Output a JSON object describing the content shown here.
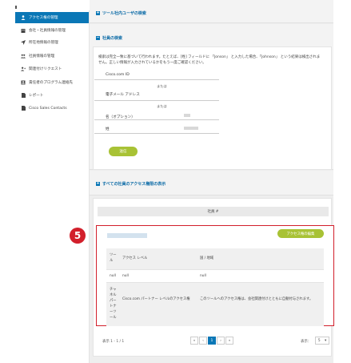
{
  "sidebar": {
    "items": [
      {
        "label": "アクセス権の管理",
        "icon": "users-icon",
        "active": true
      },
      {
        "label": "会社・社員情報の管理",
        "icon": "building-icon",
        "active": false
      },
      {
        "label": "所在地情報の管理",
        "icon": "location-arrow-icon",
        "active": false
      },
      {
        "label": "社員情報の管理",
        "icon": "group-icon",
        "active": false
      },
      {
        "label": "関連付けリクエスト",
        "icon": "user-add-icon",
        "active": false
      },
      {
        "label": "責任者のプログラム連絡先",
        "icon": "contact-icon",
        "active": false
      },
      {
        "label": "レポート",
        "icon": "document-icon",
        "active": false
      },
      {
        "label": "Cisco Sales Contacts",
        "icon": "document-icon",
        "active": false
      }
    ]
  },
  "sections": {
    "tool_user_search": "ツール社内ユーザの検索",
    "employee_search": "社員の検索",
    "all_access_display": "すべての社員のアクセス権限の表示"
  },
  "search_form": {
    "description": "検索は完全一致に基づいて行われます。たとえば、[姓] フィールドに 「Jonson」 と入力した場合、「Johnson」 という結果は検出されません。正しい情報が入力されているかをもう一度ご確認ください。",
    "cisco_id_label": "Cisco.com ID",
    "or_1": "または",
    "email_label": "電子メール アドレス",
    "or_2": "または",
    "first_name_label": "名（オプション）",
    "last_name_label": "姓",
    "submit_label": "送信"
  },
  "employee_table": {
    "header": "社員 #",
    "marker": "5",
    "edit_button": "アクセス権の編集",
    "columns": [
      "ツール",
      "アクセス レベル",
      "国 / 地域"
    ],
    "rows": [
      {
        "tool": "null",
        "access": "null",
        "country": "null"
      },
      {
        "tool": "チャネルパートナーツール",
        "access": "Cisco.com パートナー レベルのアクセス権",
        "country": "このツールへのアクセス権は、会社関連付けとともに自動付与されます。"
      }
    ]
  },
  "pagination": {
    "summary": "表示 1 - 1 / 1",
    "first": "«",
    "prev": "‹",
    "current": "1",
    "next": "›",
    "last": "»",
    "per_page_label": "表示：",
    "per_page_value": "5"
  },
  "colors": {
    "accent": "#0a77b6",
    "green_button": "#a8c235",
    "highlight_red": "#d21f2b"
  }
}
